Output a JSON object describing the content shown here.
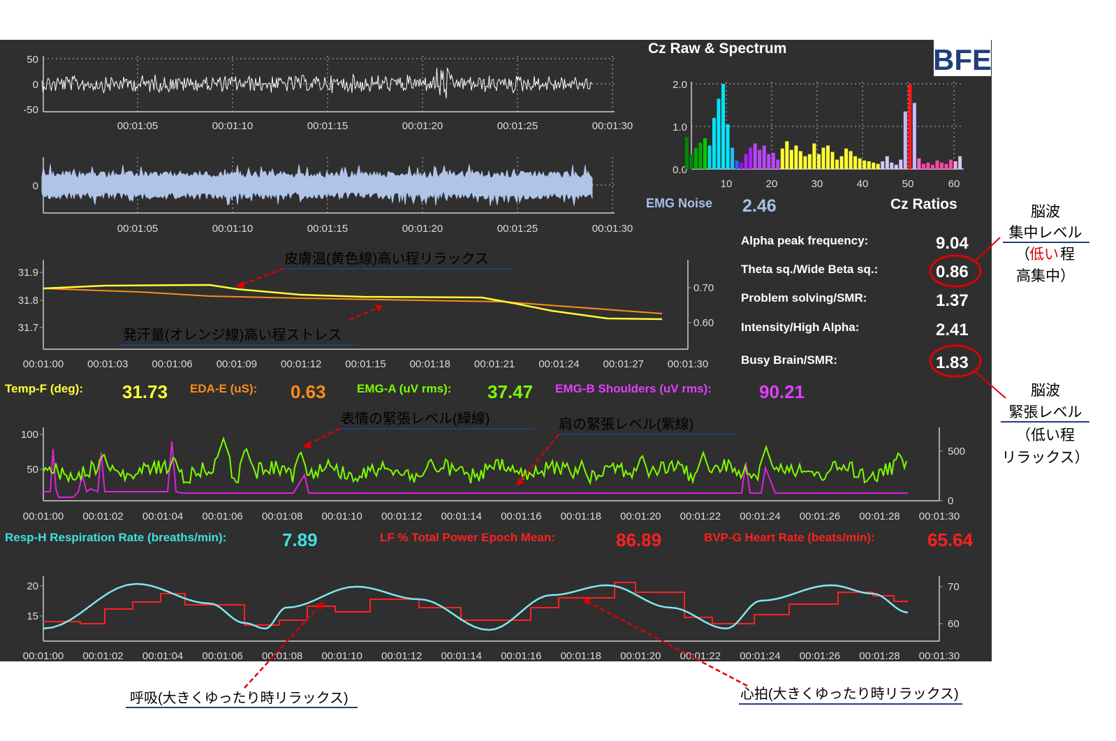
{
  "spectrum": {
    "title": "Cz Raw & Spectrum",
    "logo": "BFE",
    "y_ticks": [
      "2.0",
      "1.0",
      "0.0"
    ],
    "x_ticks": [
      "10",
      "20",
      "30",
      "40",
      "50",
      "60"
    ],
    "emg_noise_label": "EMG Noise",
    "emg_noise_value": "2.46",
    "ratios_title": "Cz Ratios"
  },
  "ratios": [
    {
      "label": "Alpha peak frequency:",
      "value": "9.04"
    },
    {
      "label": "Theta sq./Wide Beta sq.:",
      "value": "0.86"
    },
    {
      "label": "Problem solving/SMR:",
      "value": "1.37"
    },
    {
      "label": "Intensity/High Alpha:",
      "value": "2.41"
    },
    {
      "label": "Busy Brain/SMR:",
      "value": "1.83"
    }
  ],
  "eeg": {
    "raw_y_ticks": [
      "50",
      "0",
      "-50"
    ],
    "filtered_y_ticks": [
      "0"
    ],
    "time_ticks": [
      "00:01:05",
      "00:01:10",
      "00:01:15",
      "00:01:20",
      "00:01:25",
      "00:01:30"
    ],
    "colors": {
      "raw": "#ffffff",
      "filtered": "#b0c4e8"
    }
  },
  "temp_chart": {
    "left_ticks": [
      "31.9",
      "31.8",
      "31.7"
    ],
    "right_ticks": [
      "0.70",
      "0.60"
    ],
    "time_ticks": [
      "00:01:00",
      "00:01:03",
      "00:01:06",
      "00:01:09",
      "00:01:12",
      "00:01:15",
      "00:01:18",
      "00:01:21",
      "00:01:24",
      "00:01:27",
      "00:01:30"
    ],
    "annotation_temp": "皮膚温(黄色線)高い程リラックス",
    "annotation_eda": "発汗量(オレンジ線)高い程ストレス",
    "colors": {
      "temp": "#ffff33",
      "eda": "#ff8c1a"
    }
  },
  "readouts_row1": [
    {
      "label": "Temp-F (deg):",
      "value": "31.73",
      "color": "#ffff33"
    },
    {
      "label": "EDA-E (uS):",
      "value": "0.63",
      "color": "#ff8c1a"
    },
    {
      "label": "EMG-A (uV rms):",
      "value": "37.47",
      "color": "#7cfc00"
    },
    {
      "label": "EMG-B Shoulders (uV rms):",
      "value": "90.21",
      "color": "#e040fb"
    }
  ],
  "emg_chart": {
    "left_ticks": [
      "100",
      "50"
    ],
    "right_ticks": [
      "500",
      "0"
    ],
    "time_ticks": [
      "00:01:00",
      "00:01:02",
      "00:01:04",
      "00:01:06",
      "00:01:08",
      "00:01:10",
      "00:01:12",
      "00:01:14",
      "00:01:16",
      "00:01:18",
      "00:01:20",
      "00:01:22",
      "00:01:24",
      "00:01:26",
      "00:01:28",
      "00:01:30"
    ],
    "annotation_face": "表情の緊張レベル(緑線)",
    "annotation_shoulder": "肩の緊張レベル(紫線)",
    "colors": {
      "face": "#7cfc00",
      "shoulder": "#e020e0"
    }
  },
  "readouts_row2": [
    {
      "label": "Resp-H Respiration Rate (breaths/min):",
      "value": "7.89",
      "color": "#40e0e0"
    },
    {
      "label": "LF % Total Power Epoch Mean:",
      "value": "86.89",
      "color": "#ff2020"
    },
    {
      "label": "BVP-G  Heart Rate (beats/min):",
      "value": "65.64",
      "color": "#ff2020"
    }
  ],
  "resp_chart": {
    "left_ticks": [
      "20",
      "15"
    ],
    "right_ticks": [
      "70",
      "60"
    ],
    "time_ticks": [
      "00:01:00",
      "00:01:02",
      "00:01:04",
      "00:01:06",
      "00:01:08",
      "00:01:10",
      "00:01:12",
      "00:01:14",
      "00:01:16",
      "00:01:18",
      "00:01:20",
      "00:01:22",
      "00:01:24",
      "00:01:26",
      "00:01:28",
      "00:01:30"
    ],
    "colors": {
      "resp": "#80e8f0",
      "hr": "#ff2020"
    }
  },
  "annotations": {
    "breath": "呼吸(大きくゆったり時リラックス)",
    "heart": "心拍(大きくゆったり時リラックス)",
    "focus": [
      "脳波",
      "集中レベル",
      "（",
      "低い",
      "程",
      "高集中）"
    ],
    "tension": [
      "脳波",
      "緊張レベル",
      "（低い程",
      "リラックス）"
    ]
  }
}
